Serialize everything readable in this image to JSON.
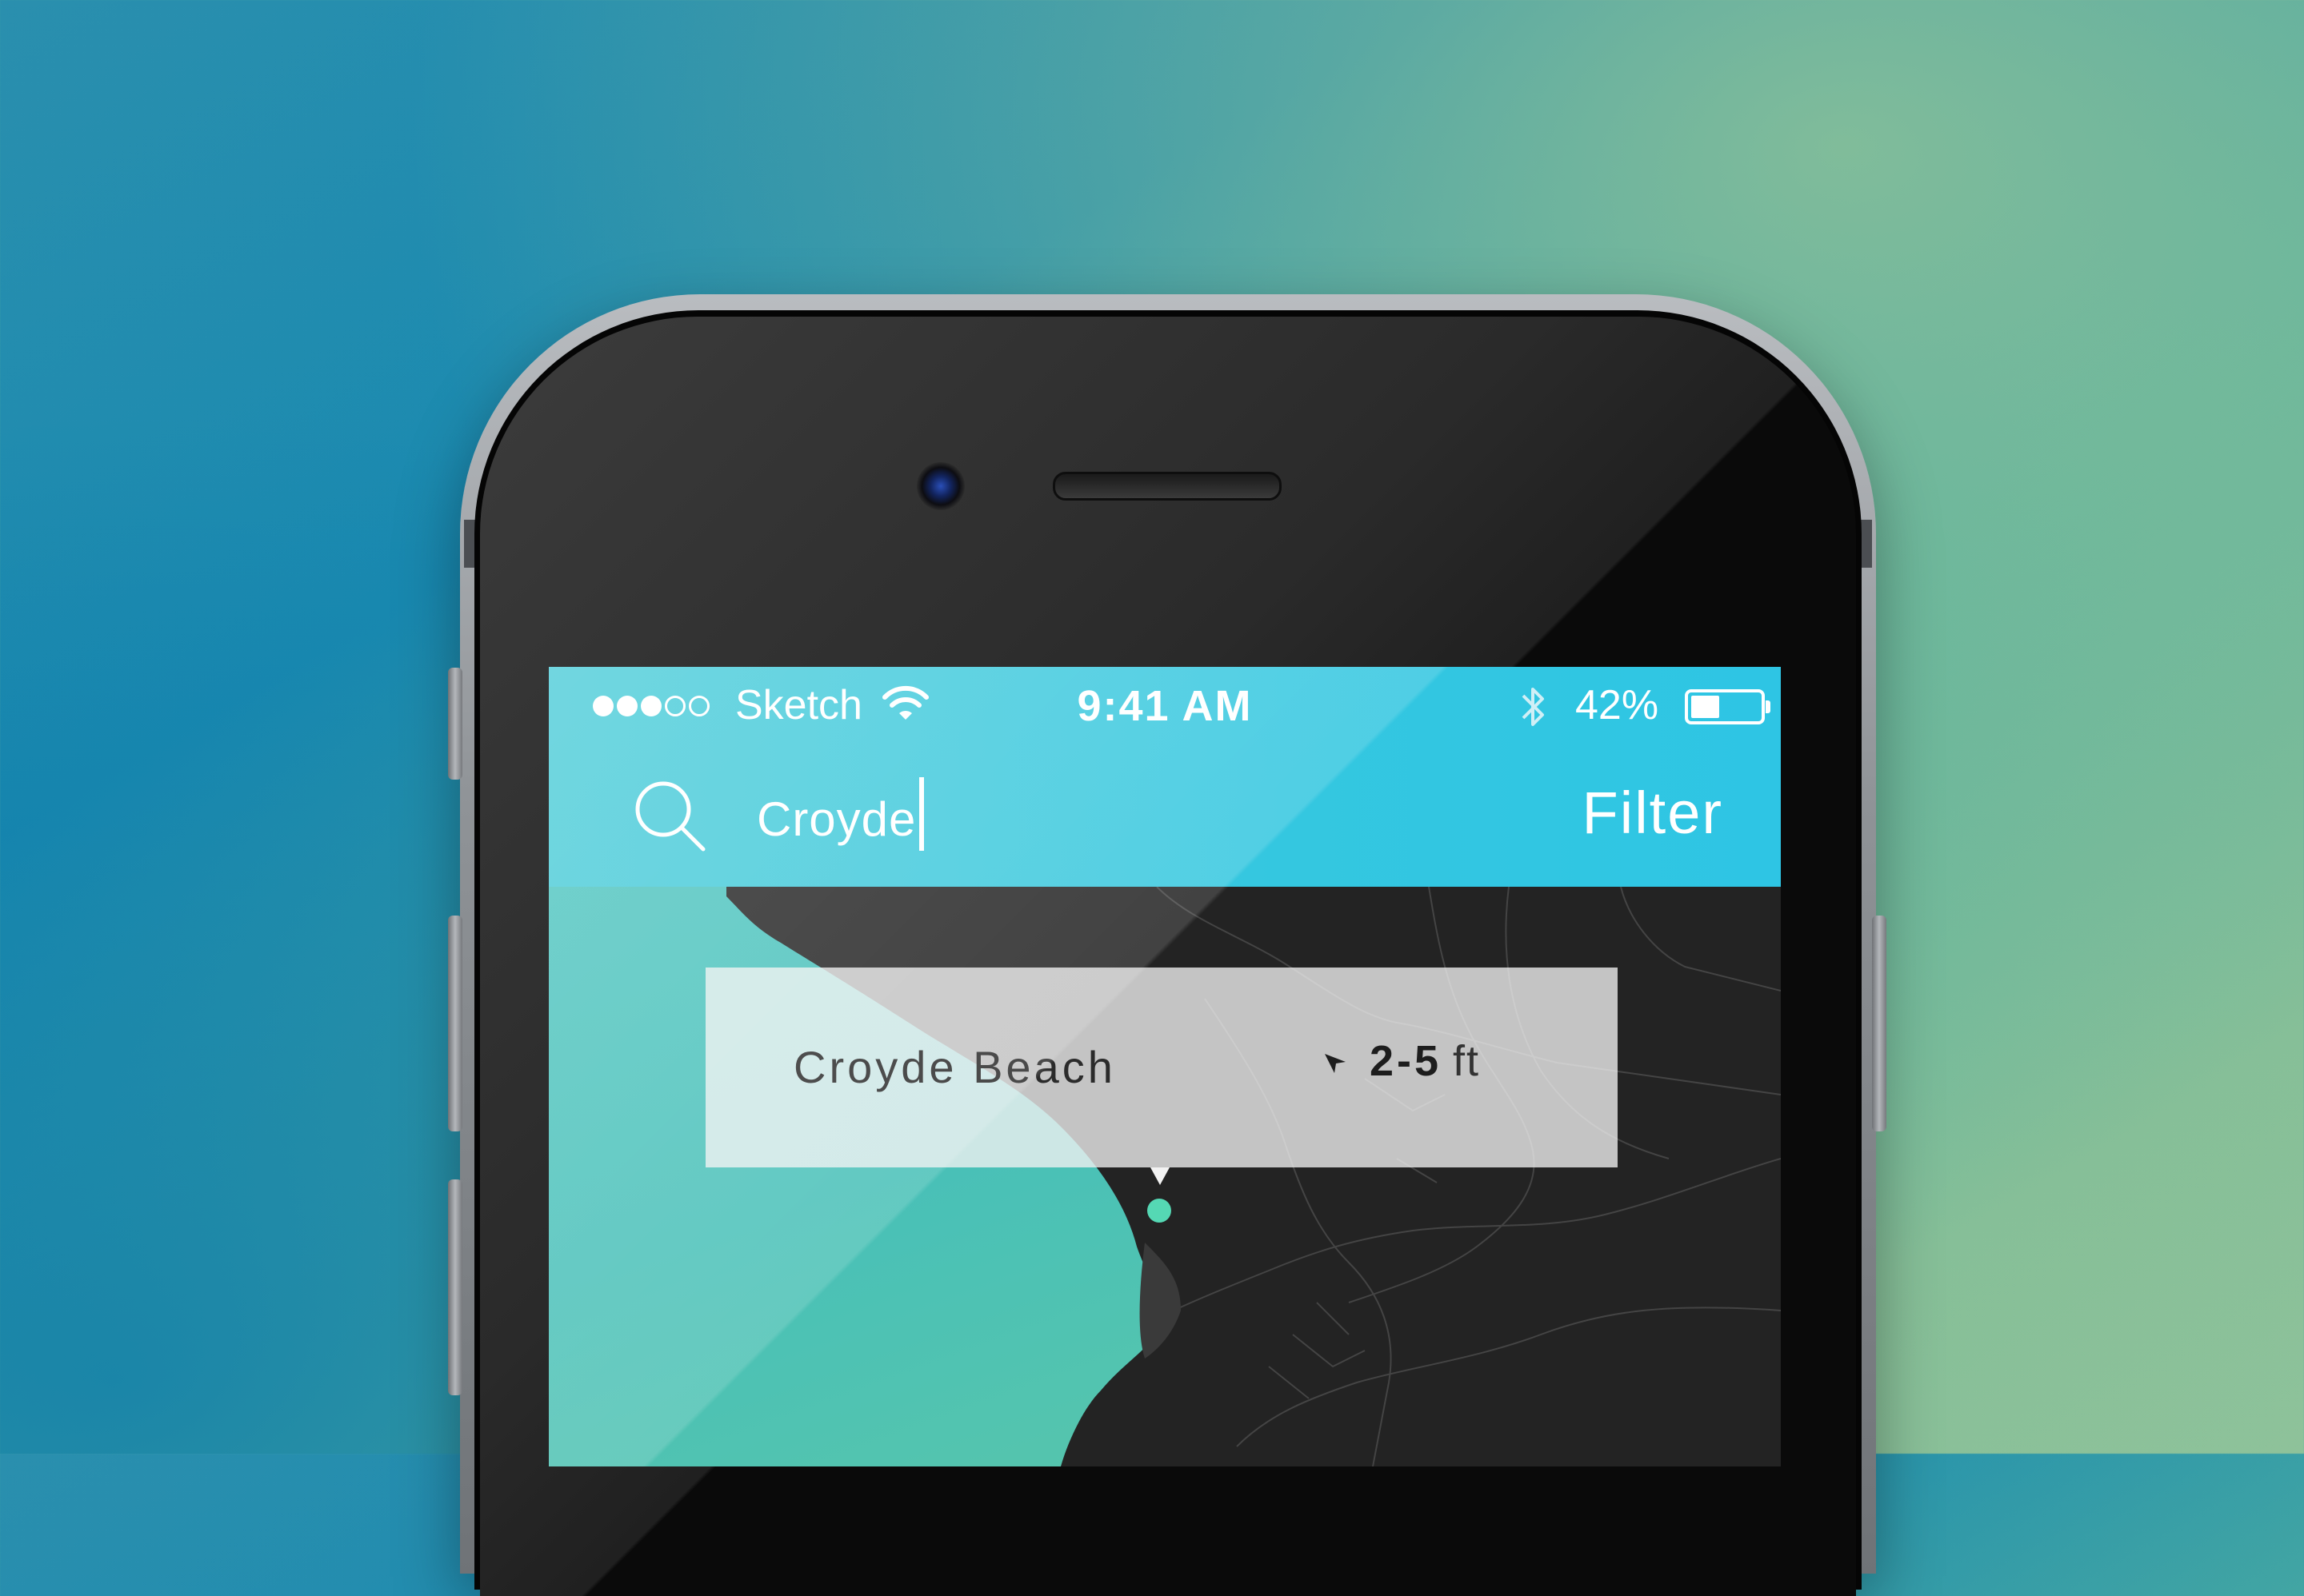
{
  "status_bar": {
    "signal_full": 3,
    "signal_total": 5,
    "carrier": "Sketch",
    "time": "9:41 AM",
    "battery_percent": "42%",
    "battery_level": 0.42
  },
  "search": {
    "value": "Croyde",
    "icon": "search-icon"
  },
  "filter_label": "Filter",
  "result": {
    "name": "Croyde Beach",
    "swell_range": "2-5",
    "swell_unit": "ft",
    "direction_icon": "direction-arrow-icon"
  },
  "colors": {
    "header": "#2ec5e4",
    "sea": "#4fc6c3",
    "land": "#232323",
    "pin": "#55d8b4"
  }
}
